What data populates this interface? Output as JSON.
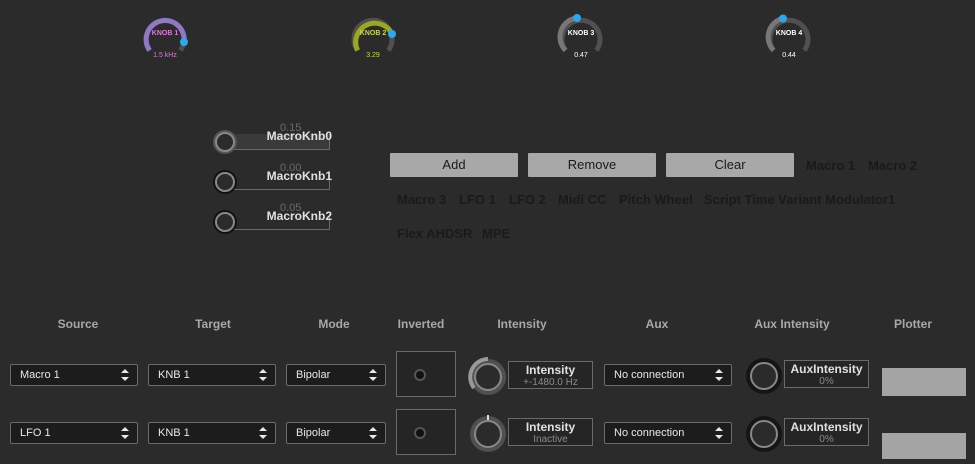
{
  "top_knobs": [
    {
      "label": "KNOB 1",
      "value": "1.5 kHz",
      "label_color": "#e07ad8",
      "value_color": "#e07ad8",
      "arc_color": "#8f78c4"
    },
    {
      "label": "KNOB 2",
      "value": "3.29",
      "label_color": "#c8d848",
      "value_color": "#c8d848",
      "arc_color": "#9aa81c"
    },
    {
      "label": "KNOB 3",
      "value": "0.47",
      "label_color": "#ffffff",
      "value_color": "#ffffff",
      "arc_color": "#777777"
    },
    {
      "label": "KNOB 4",
      "value": "0.44",
      "label_color": "#ffffff",
      "value_color": "#ffffff",
      "arc_color": "#777777"
    }
  ],
  "macros": [
    {
      "label": "MacroKnb0",
      "value": "0.15"
    },
    {
      "label": "MacroKnb1",
      "value": "0.00"
    },
    {
      "label": "MacroKnb2",
      "value": "0.05"
    }
  ],
  "buttons": {
    "add": "Add",
    "remove": "Remove",
    "clear": "Clear"
  },
  "sources": [
    "Macro 1",
    "Macro 2",
    "Macro 3",
    "LFO 1",
    "LFO 2",
    "Midi CC",
    "Pitch Wheel",
    "Script Time Variant Modulator1",
    "Flex AHDSR",
    "MPE"
  ],
  "columns": {
    "source": "Source",
    "target": "Target",
    "mode": "Mode",
    "inverted": "Inverted",
    "intensity": "Intensity",
    "aux": "Aux",
    "aux_intensity": "Aux Intensity",
    "plotter": "Plotter"
  },
  "rows": [
    {
      "source": "Macro 1",
      "target": "KNB 1",
      "mode": "Bipolar",
      "intensity_label": "Intensity",
      "intensity_value": "+-1480.0 Hz",
      "aux": "No connection",
      "aux_label": "AuxIntensity",
      "aux_value": "0%"
    },
    {
      "source": "LFO 1",
      "target": "KNB 1",
      "mode": "Bipolar",
      "intensity_label": "Intensity",
      "intensity_value": "Inactive",
      "aux": "No connection",
      "aux_label": "AuxIntensity",
      "aux_value": "0%"
    }
  ],
  "accent_color": "#2aa8f0"
}
